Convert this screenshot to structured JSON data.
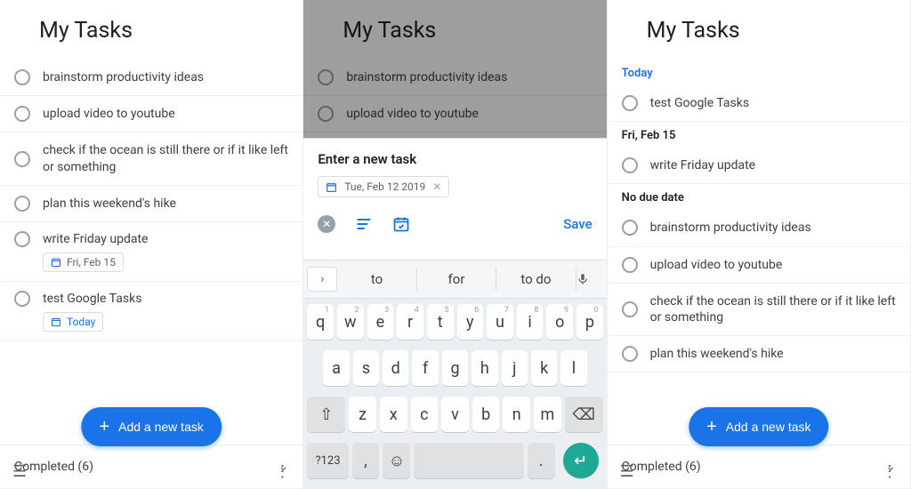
{
  "colors": {
    "accent": "#1a73e8"
  },
  "pane1": {
    "title": "My Tasks",
    "tasks": [
      {
        "text": "brainstorm productivity ideas"
      },
      {
        "text": "upload video to youtube"
      },
      {
        "text": "check if the ocean is still there or if it like left or something"
      },
      {
        "text": "plan this weekend's hike"
      },
      {
        "text": "write Friday update",
        "chip": "Fri, Feb 15"
      },
      {
        "text": "test Google Tasks",
        "chip": "Today",
        "chip_today": true
      }
    ],
    "completed_label": "Completed (6)",
    "fab_label": "Add a new task"
  },
  "pane2": {
    "title": "My Tasks",
    "ghost_tasks": [
      "brainstorm productivity ideas",
      "upload video to youtube"
    ],
    "input_placeholder": "Enter a new task",
    "date_chip": "Tue, Feb 12 2019",
    "save_label": "Save",
    "suggestions": [
      "to",
      "for",
      "to do"
    ],
    "keyboard": {
      "row1": [
        [
          "q",
          "1"
        ],
        [
          "w",
          "2"
        ],
        [
          "e",
          "3"
        ],
        [
          "r",
          "4"
        ],
        [
          "t",
          "5"
        ],
        [
          "y",
          "6"
        ],
        [
          "u",
          "7"
        ],
        [
          "i",
          "8"
        ],
        [
          "o",
          "9"
        ],
        [
          "p",
          "0"
        ]
      ],
      "row2": [
        "a",
        "s",
        "d",
        "f",
        "g",
        "h",
        "j",
        "k",
        "l"
      ],
      "row3": [
        "z",
        "x",
        "c",
        "v",
        "b",
        "n",
        "m"
      ],
      "sym": "?123",
      "comma": ",",
      "period": "."
    }
  },
  "pane3": {
    "title": "My Tasks",
    "sections": [
      {
        "label": "Today",
        "today": true,
        "tasks": [
          "test Google Tasks"
        ]
      },
      {
        "label": "Fri, Feb 15",
        "tasks": [
          "write Friday update"
        ]
      },
      {
        "label": "No due date",
        "tasks": [
          "brainstorm productivity ideas",
          "upload video to youtube",
          "check if the ocean is still there or if it like left or something",
          "plan this weekend's hike"
        ]
      }
    ],
    "completed_label": "Completed (6)",
    "fab_label": "Add a new task"
  }
}
